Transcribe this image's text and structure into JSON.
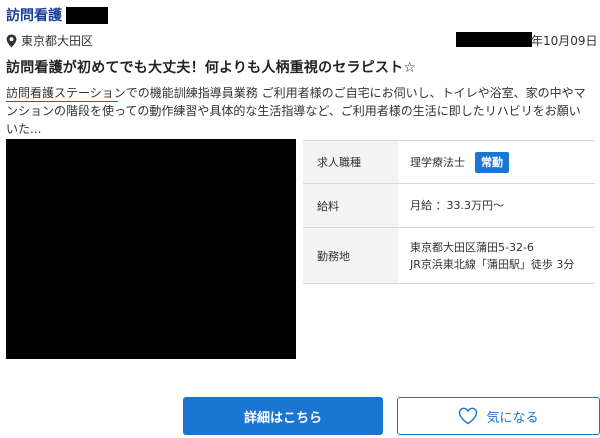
{
  "listing": {
    "title": "訪問看護",
    "location": "東京都大田区",
    "date": "年10月09日",
    "headline": "訪問看護が初めてでも大丈夫！何よりも人柄重視のセラピスト☆",
    "description_highlight": "訪問看護ステーション",
    "description_rest": "での機能訓練指導員業務 ご利用者様のご自宅にお伺いし、トイレや浴室、家の中やマンションの階段を使っての動作練習や具体的な生活指導など、ご利用者様の生活に即したリハビリをお願いいた...",
    "accent_color": "#1976d2",
    "highlight_underline_color": "#e02020"
  },
  "info": {
    "job_label": "求人職種",
    "job_value": "理学療法士",
    "employment_badge": "常勤",
    "salary_label": "給料",
    "salary_value": "月給 ：33.3万円～",
    "workplace_label": "勤務地",
    "workplace_address": "東京都大田区蒲田5-32-6",
    "workplace_access": "JR京浜東北線「蒲田駅」徒歩 3分"
  },
  "actions": {
    "detail_label": "詳細はこちら",
    "favorite_label": "気になる",
    "favorite_icon": "heart-outline-icon",
    "location_icon": "map-pin-icon"
  }
}
